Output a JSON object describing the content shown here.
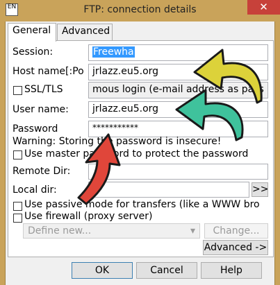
{
  "window": {
    "title": "FTP: connection details",
    "close_glyph": "✕",
    "icon": "app-icon"
  },
  "tabs": [
    {
      "label": "General"
    },
    {
      "label": "Advanced"
    }
  ],
  "form": {
    "session": {
      "label": "Session:",
      "value": "Freewha"
    },
    "host": {
      "label": "Host name[:Po",
      "value": "jrlazz.eu5.org"
    },
    "ssl": {
      "label": "SSL/TLS",
      "hint": "mous login (e-mail address as pass"
    },
    "user": {
      "label": "User name:",
      "value": "jrlazz.eu5.org"
    },
    "password": {
      "label": "Password",
      "value": "***********"
    },
    "warning": "Warning: Storing the password is insecure!",
    "master_password": "Use master password to protect the password",
    "remote_dir": {
      "label": "Remote Dir:",
      "value": ""
    },
    "local_dir": {
      "label": "Local dir:",
      "value": "",
      "browse_label": ">>"
    },
    "passive": "Use passive mode for transfers (like a WWW bro",
    "firewall": "Use firewall (proxy server)",
    "define_new": {
      "value": "Define new...",
      "arrow": "▾"
    },
    "change_label": "Change...",
    "advanced_label": "Advanced ->"
  },
  "buttons": {
    "ok": "OK",
    "cancel": "Cancel",
    "help": "Help"
  },
  "colors": {
    "arrow_yellow": "#dcd23a",
    "arrow_teal": "#3fc29c",
    "arrow_red": "#e0463a",
    "titlebar": "#c9a35a",
    "selection": "#3399ff"
  }
}
